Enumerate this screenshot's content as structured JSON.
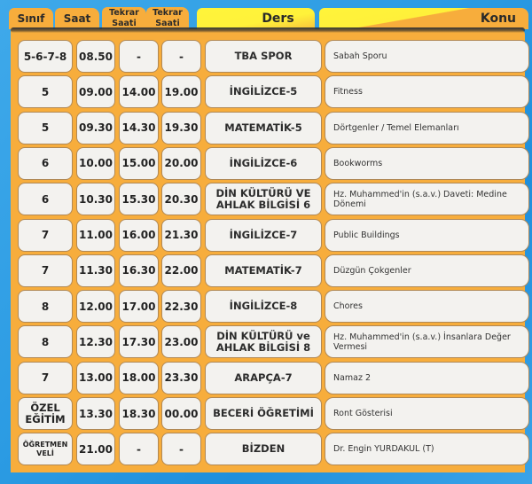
{
  "header": {
    "sinif": "Sınıf",
    "saat": "Saat",
    "tekrar1_line1": "Tekrar",
    "tekrar1_line2": "Saati",
    "tekrar2_line1": "Tekrar",
    "tekrar2_line2": "Saati",
    "ders": "Ders",
    "konu": "Konu"
  },
  "colors": {
    "panel": "#f7ad3c",
    "yellow_tab": "#fff23a",
    "cell": "#f3f2ef",
    "background": "#2b9be3"
  },
  "rows": [
    {
      "sinif": "5-6-7-8",
      "saat": "08.50",
      "tekrar1": "-",
      "tekrar2": "-",
      "ders": "TBA SPOR",
      "konu": "Sabah Sporu"
    },
    {
      "sinif": "5",
      "saat": "09.00",
      "tekrar1": "14.00",
      "tekrar2": "19.00",
      "ders": "İNGİLİZCE-5",
      "konu": "Fitness"
    },
    {
      "sinif": "5",
      "saat": "09.30",
      "tekrar1": "14.30",
      "tekrar2": "19.30",
      "ders": "MATEMATİK-5",
      "konu": "Dörtgenler / Temel Elemanları"
    },
    {
      "sinif": "6",
      "saat": "10.00",
      "tekrar1": "15.00",
      "tekrar2": "20.00",
      "ders": "İNGİLİZCE-6",
      "konu": "Bookworms"
    },
    {
      "sinif": "6",
      "saat": "10.30",
      "tekrar1": "15.30",
      "tekrar2": "20.30",
      "ders": "DİN KÜLTÜRÜ VE AHLAK BİLGİSİ 6",
      "konu": "Hz. Muhammed'in (s.a.v.) Daveti: Medine Dönemi"
    },
    {
      "sinif": "7",
      "saat": "11.00",
      "tekrar1": "16.00",
      "tekrar2": "21.30",
      "ders": "İNGİLİZCE-7",
      "konu": "Public Buildings"
    },
    {
      "sinif": "7",
      "saat": "11.30",
      "tekrar1": "16.30",
      "tekrar2": "22.00",
      "ders": "MATEMATİK-7",
      "konu": "Düzgün Çokgenler"
    },
    {
      "sinif": "8",
      "saat": "12.00",
      "tekrar1": "17.00",
      "tekrar2": "22.30",
      "ders": "İNGİLİZCE-8",
      "konu": "Chores"
    },
    {
      "sinif": "8",
      "saat": "12.30",
      "tekrar1": "17.30",
      "tekrar2": "23.00",
      "ders": "DİN KÜLTÜRÜ ve AHLAK BİLGİSİ 8",
      "konu": "Hz. Muhammed'in (s.a.v.) İnsanlara Değer Vermesi"
    },
    {
      "sinif": "7",
      "saat": "13.00",
      "tekrar1": "18.00",
      "tekrar2": "23.30",
      "ders": "ARAPÇA-7",
      "konu": "Namaz 2"
    },
    {
      "sinif": "ÖZEL EĞİTİM",
      "saat": "13.30",
      "tekrar1": "18.30",
      "tekrar2": "00.00",
      "ders": "BECERİ ÖĞRETİMİ",
      "konu": "Ront Gösterisi"
    },
    {
      "sinif": "ÖĞRETMEN VELİ",
      "saat": "21.00",
      "tekrar1": "-",
      "tekrar2": "-",
      "ders": "BİZDEN",
      "konu": "Dr. Engin YURDAKUL (T)"
    }
  ]
}
